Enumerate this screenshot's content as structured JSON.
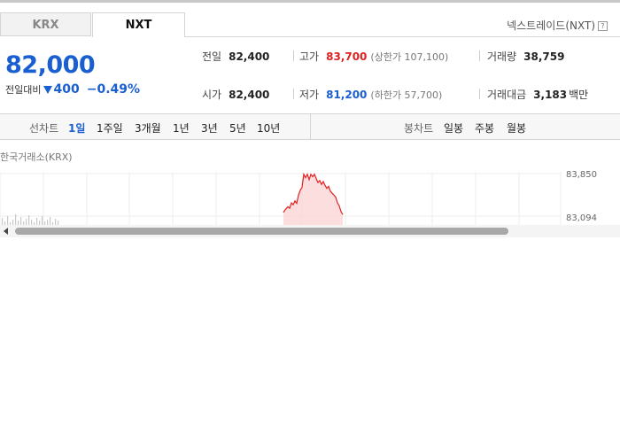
{
  "tabs": [
    {
      "label": "KRX"
    },
    {
      "label": "NXT"
    }
  ],
  "nxt_link": "넥스트레이드(NXT)",
  "summary": {
    "price": "82,000",
    "change_label": "전일대비",
    "change": "400",
    "change_pct": "−0.49%",
    "prev": {
      "label": "전일",
      "value": "82,400"
    },
    "open": {
      "label": "시가",
      "value": "82,400"
    },
    "high": {
      "label": "고가",
      "value": "83,700",
      "sub": "(상한가 107,100)"
    },
    "low": {
      "label": "저가",
      "value": "81,200",
      "sub": "(하한가 57,700)"
    },
    "volume": {
      "label": "거래량",
      "value": "38,759"
    },
    "amount": {
      "label": "거래대금",
      "value": "3,183",
      "unit": "백만"
    }
  },
  "toolbar": {
    "line_label": "선차트",
    "line_periods": [
      "1일",
      "1주일",
      "3개월",
      "1년",
      "3년",
      "5년",
      "10년"
    ],
    "active": "1일",
    "candle_label": "봉차트",
    "candle_periods": [
      "일봉",
      "주봉",
      "월봉"
    ]
  },
  "chart_data": {
    "type": "line",
    "title": "한국거래소(KRX)",
    "ylim": [
      82950,
      83900
    ],
    "yticks": [
      "83,850",
      "83,094"
    ],
    "color_up": "#e02020",
    "series": [
      {
        "values": [
          {
            "x": 320,
            "y": 83060
          },
          {
            "x": 322,
            "y": 83120
          },
          {
            "x": 325,
            "y": 83180
          },
          {
            "x": 327,
            "y": 83150
          },
          {
            "x": 329,
            "y": 83260
          },
          {
            "x": 331,
            "y": 83220
          },
          {
            "x": 333,
            "y": 83300
          },
          {
            "x": 335,
            "y": 83250
          },
          {
            "x": 337,
            "y": 83420
          },
          {
            "x": 339,
            "y": 83520
          },
          {
            "x": 341,
            "y": 83580
          },
          {
            "x": 343,
            "y": 83850
          },
          {
            "x": 345,
            "y": 83780
          },
          {
            "x": 347,
            "y": 83850
          },
          {
            "x": 349,
            "y": 83740
          },
          {
            "x": 351,
            "y": 83850
          },
          {
            "x": 353,
            "y": 83800
          },
          {
            "x": 355,
            "y": 83850
          },
          {
            "x": 357,
            "y": 83760
          },
          {
            "x": 359,
            "y": 83680
          },
          {
            "x": 361,
            "y": 83720
          },
          {
            "x": 363,
            "y": 83640
          },
          {
            "x": 365,
            "y": 83700
          },
          {
            "x": 367,
            "y": 83620
          },
          {
            "x": 369,
            "y": 83560
          },
          {
            "x": 371,
            "y": 83600
          },
          {
            "x": 373,
            "y": 83500
          },
          {
            "x": 375,
            "y": 83460
          },
          {
            "x": 377,
            "y": 83420
          },
          {
            "x": 379,
            "y": 83380
          },
          {
            "x": 381,
            "y": 83260
          },
          {
            "x": 383,
            "y": 83200
          },
          {
            "x": 385,
            "y": 83080
          },
          {
            "x": 387,
            "y": 83020
          }
        ]
      }
    ]
  }
}
